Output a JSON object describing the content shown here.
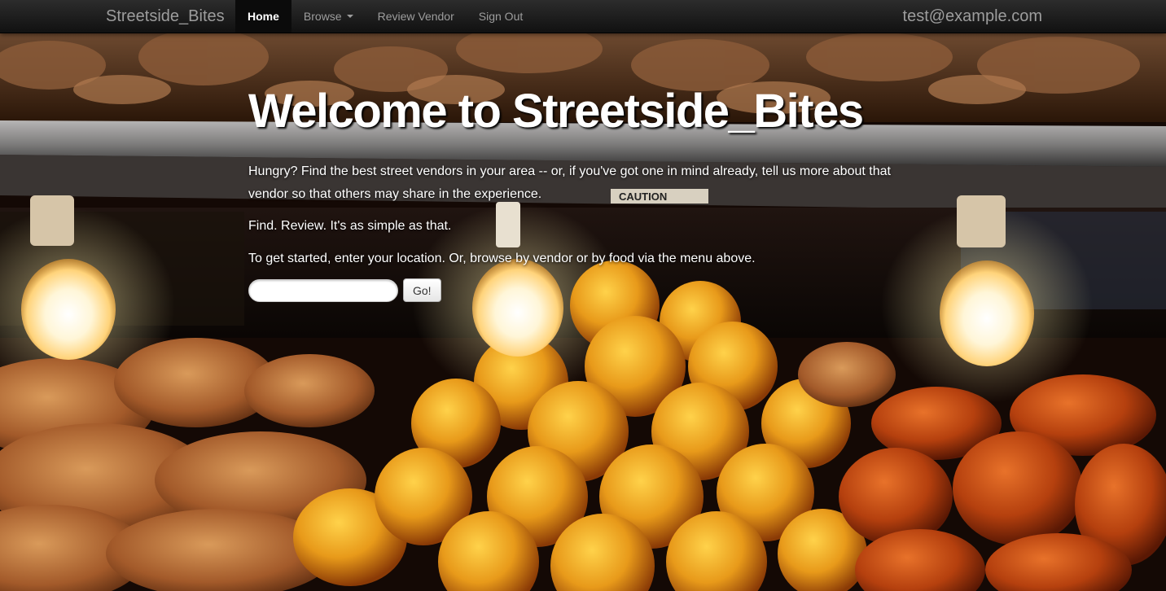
{
  "navbar": {
    "brand": "Streetside_Bites",
    "items": [
      {
        "label": "Home",
        "active": true
      },
      {
        "label": "Browse",
        "dropdown": true
      },
      {
        "label": "Review Vendor"
      },
      {
        "label": "Sign Out"
      }
    ],
    "user_email": "test@example.com"
  },
  "hero": {
    "title": "Welcome to Streetside_Bites",
    "intro": "Hungry? Find the best street vendors in your area -- or, if you've got one in mind already, tell us more about that vendor so that others may share in the experience.",
    "tagline": "Find. Review. It's as simple as that.",
    "instructions": "To get started, enter your location. Or, browse by vendor or by food via the menu above.",
    "location_input_value": "",
    "go_label": "Go!"
  },
  "colors": {
    "navbar_bg": "#1b1b1b",
    "nav_text": "#9d9d9d",
    "nav_active_text": "#ffffff",
    "hero_text": "#ffffff"
  },
  "background": {
    "caution_sign": "CAUTION"
  }
}
